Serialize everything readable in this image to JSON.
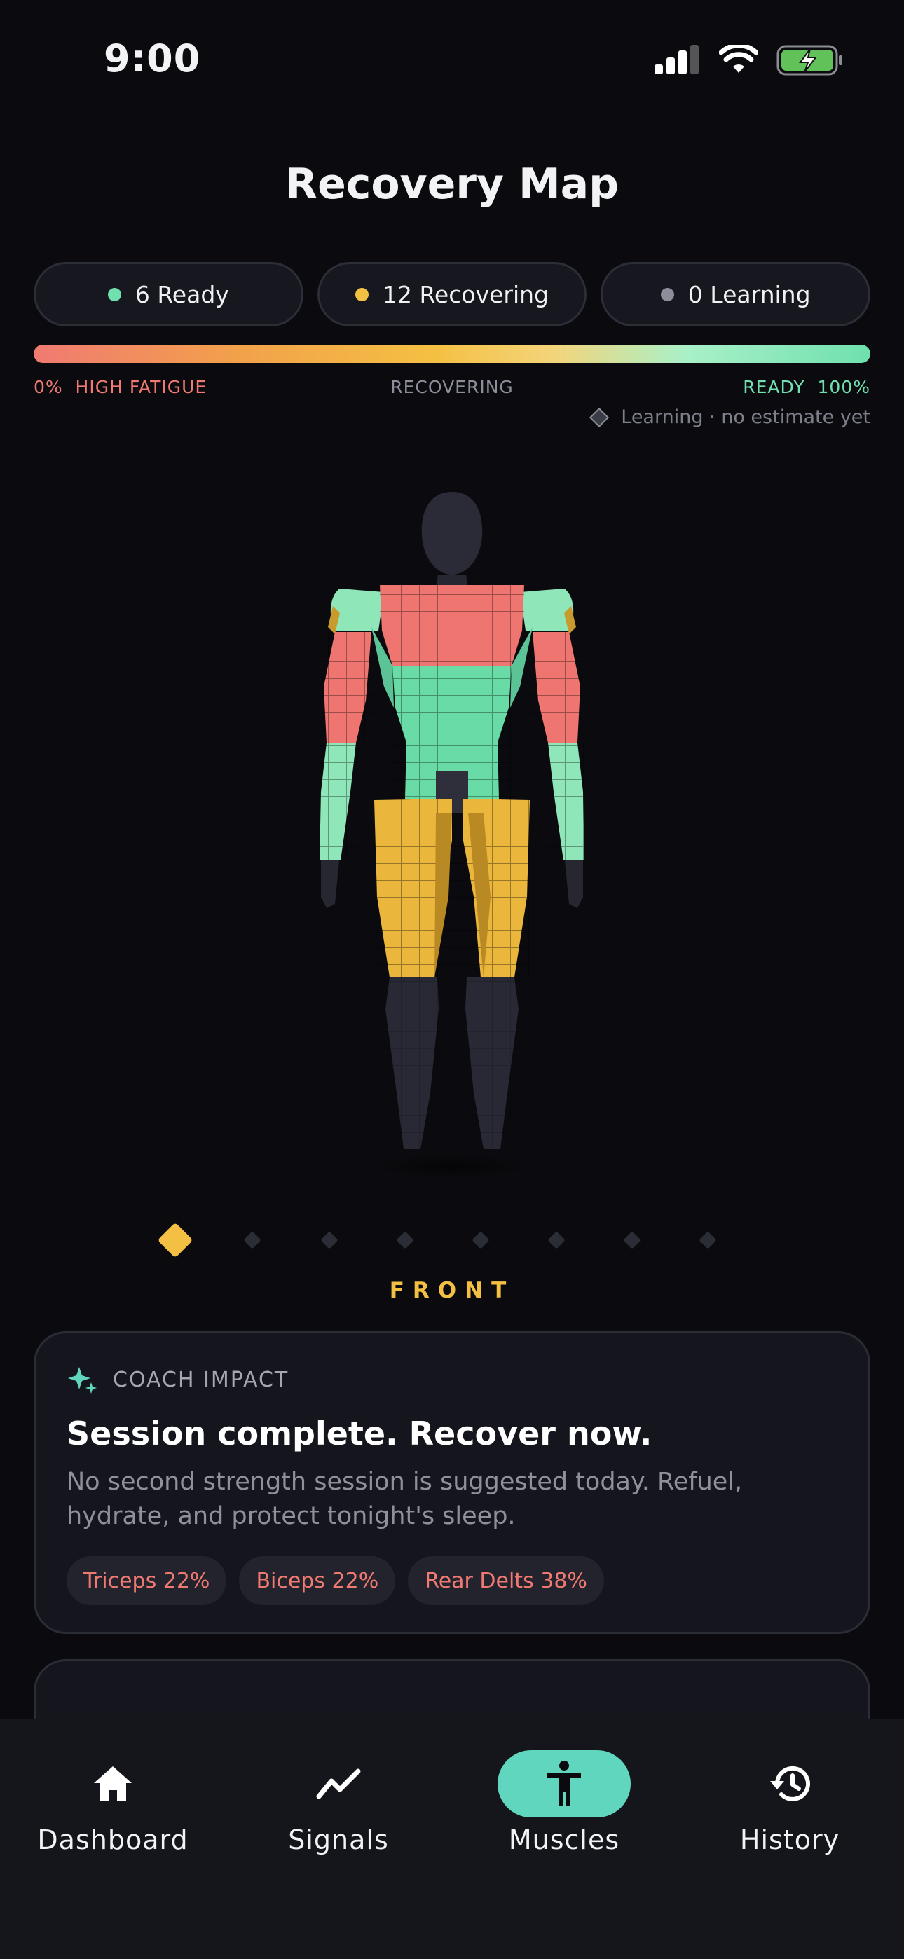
{
  "status_bar": {
    "time": "9:00"
  },
  "page": {
    "title": "Recovery Map"
  },
  "pills": [
    {
      "label": "6 Ready",
      "color": "#6fe0ae"
    },
    {
      "label": "12 Recovering",
      "color": "#f4c043"
    },
    {
      "label": "0 Learning",
      "color": "#8c8f99"
    }
  ],
  "scale": {
    "left": "0%  HIGH FATIGUE",
    "middle": "RECOVERING",
    "right": "READY  100%",
    "learning_note": "Learning · no estimate yet"
  },
  "colors": {
    "ready": "#6fe0ae",
    "recovering": "#f4c043",
    "fatigued": "#f07a72",
    "learning": "#8c8f99",
    "accent": "#5fd6bd"
  },
  "views": {
    "selected_index": 0,
    "count": 8,
    "label": "FRONT"
  },
  "coach_card": {
    "heading": "COACH IMPACT",
    "title": "Session complete. Recover now.",
    "text": "No second strength session is suggested today. Refuel, hydrate, and protect tonight's sleep.",
    "chips": [
      "Triceps 22%",
      "Biceps 22%",
      "Rear Delts 38%"
    ]
  },
  "tabs": [
    {
      "label": "Dashboard",
      "icon": "home-icon",
      "active": false
    },
    {
      "label": "Signals",
      "icon": "trend-icon",
      "active": false
    },
    {
      "label": "Muscles",
      "icon": "person-icon",
      "active": true
    },
    {
      "label": "History",
      "icon": "history-icon",
      "active": false
    }
  ]
}
